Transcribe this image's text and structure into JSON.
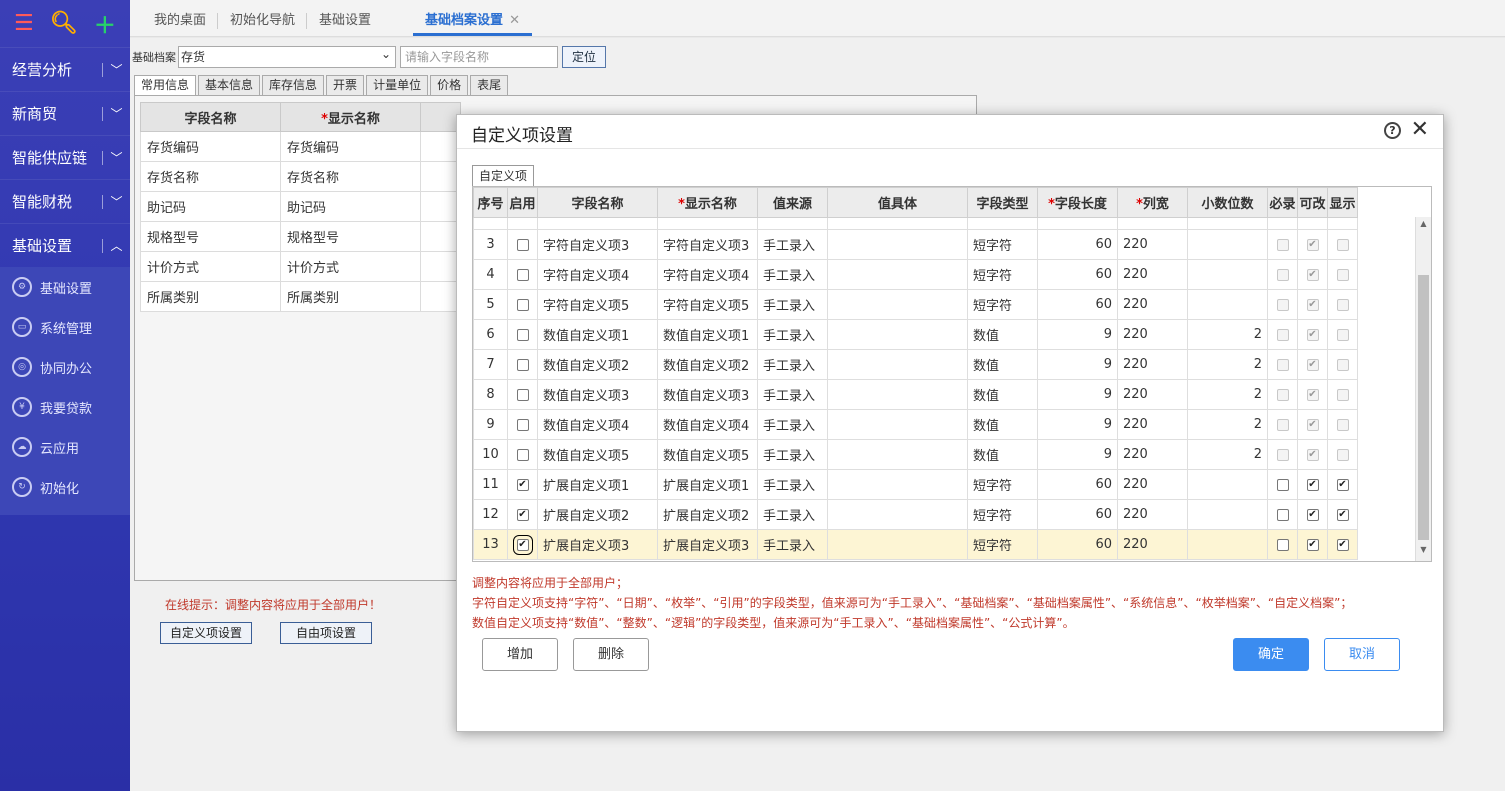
{
  "sidebar": {
    "menus": [
      {
        "label": "经营分析"
      },
      {
        "label": "新商贸"
      },
      {
        "label": "智能供应链"
      },
      {
        "label": "智能财税"
      },
      {
        "label": "基础设置"
      }
    ],
    "sub_items": [
      {
        "label": "基础设置",
        "icon": "gear-icon"
      },
      {
        "label": "系统管理",
        "icon": "monitor-icon"
      },
      {
        "label": "协同办公",
        "icon": "collaboration-icon"
      },
      {
        "label": "我要贷款",
        "icon": "money-icon"
      },
      {
        "label": "云应用",
        "icon": "cloud-icon"
      },
      {
        "label": "初始化",
        "icon": "refresh-icon"
      }
    ]
  },
  "top_tabs": [
    {
      "label": "我的桌面"
    },
    {
      "label": "初始化导航"
    },
    {
      "label": "基础设置"
    },
    {
      "label": "基础档案设置"
    }
  ],
  "filter": {
    "label": "基础档案",
    "select_value": "存货",
    "search_placeholder": "请输入字段名称",
    "locate_button": "定位"
  },
  "sub_tabs": [
    "常用信息",
    "基本信息",
    "库存信息",
    "开票",
    "计量单位",
    "价格",
    "表尾"
  ],
  "left_grid": {
    "headers": [
      "字段名称",
      "显示名称"
    ],
    "header_required_mark": "*",
    "rows": [
      [
        "存货编码",
        "存货编码"
      ],
      [
        "存货名称",
        "存货名称"
      ],
      [
        "助记码",
        "助记码"
      ],
      [
        "规格型号",
        "规格型号"
      ],
      [
        "计价方式",
        "计价方式"
      ],
      [
        "所属类别",
        "所属类别"
      ]
    ]
  },
  "left_tip": "在线提示：调整内容将应用于全部用户！",
  "left_buttons": {
    "custom": "自定义项设置",
    "free": "自由项设置"
  },
  "dialog": {
    "title": "自定义项设置",
    "tab": "自定义项",
    "headers": [
      "序号",
      "启用",
      "字段名称",
      "显示名称",
      "值来源",
      "值具体",
      "字段类型",
      "字段长度",
      "列宽",
      "小数位数",
      "必录",
      "可改",
      "显示"
    ],
    "required_mark": "*",
    "rows": [
      {
        "no": "3",
        "enabled": false,
        "field": "字符自定义项3",
        "display": "字符自定义项3",
        "source": "手工录入",
        "detail": "",
        "type": "短字符",
        "length": "60",
        "width": "220",
        "decimals": "",
        "required": false,
        "editable": true,
        "show": false,
        "locked": true
      },
      {
        "no": "4",
        "enabled": false,
        "field": "字符自定义项4",
        "display": "字符自定义项4",
        "source": "手工录入",
        "detail": "",
        "type": "短字符",
        "length": "60",
        "width": "220",
        "decimals": "",
        "required": false,
        "editable": true,
        "show": false,
        "locked": true
      },
      {
        "no": "5",
        "enabled": false,
        "field": "字符自定义项5",
        "display": "字符自定义项5",
        "source": "手工录入",
        "detail": "",
        "type": "短字符",
        "length": "60",
        "width": "220",
        "decimals": "",
        "required": false,
        "editable": true,
        "show": false,
        "locked": true
      },
      {
        "no": "6",
        "enabled": false,
        "field": "数值自定义项1",
        "display": "数值自定义项1",
        "source": "手工录入",
        "detail": "",
        "type": "数值",
        "length": "9",
        "width": "220",
        "decimals": "2",
        "required": false,
        "editable": true,
        "show": false,
        "locked": true
      },
      {
        "no": "7",
        "enabled": false,
        "field": "数值自定义项2",
        "display": "数值自定义项2",
        "source": "手工录入",
        "detail": "",
        "type": "数值",
        "length": "9",
        "width": "220",
        "decimals": "2",
        "required": false,
        "editable": true,
        "show": false,
        "locked": true
      },
      {
        "no": "8",
        "enabled": false,
        "field": "数值自定义项3",
        "display": "数值自定义项3",
        "source": "手工录入",
        "detail": "",
        "type": "数值",
        "length": "9",
        "width": "220",
        "decimals": "2",
        "required": false,
        "editable": true,
        "show": false,
        "locked": true
      },
      {
        "no": "9",
        "enabled": false,
        "field": "数值自定义项4",
        "display": "数值自定义项4",
        "source": "手工录入",
        "detail": "",
        "type": "数值",
        "length": "9",
        "width": "220",
        "decimals": "2",
        "required": false,
        "editable": true,
        "show": false,
        "locked": true
      },
      {
        "no": "10",
        "enabled": false,
        "field": "数值自定义项5",
        "display": "数值自定义项5",
        "source": "手工录入",
        "detail": "",
        "type": "数值",
        "length": "9",
        "width": "220",
        "decimals": "2",
        "required": false,
        "editable": true,
        "show": false,
        "locked": true
      },
      {
        "no": "11",
        "enabled": true,
        "field": "扩展自定义项1",
        "display": "扩展自定义项1",
        "source": "手工录入",
        "detail": "",
        "type": "短字符",
        "length": "60",
        "width": "220",
        "decimals": "",
        "required": false,
        "editable": true,
        "show": true,
        "locked": false
      },
      {
        "no": "12",
        "enabled": true,
        "field": "扩展自定义项2",
        "display": "扩展自定义项2",
        "source": "手工录入",
        "detail": "",
        "type": "短字符",
        "length": "60",
        "width": "220",
        "decimals": "",
        "required": false,
        "editable": true,
        "show": true,
        "locked": false
      },
      {
        "no": "13",
        "enabled": true,
        "field": "扩展自定义项3",
        "display": "扩展自定义项3",
        "source": "手工录入",
        "detail": "",
        "type": "短字符",
        "length": "60",
        "width": "220",
        "decimals": "",
        "required": false,
        "editable": true,
        "show": true,
        "locked": false,
        "selected": true
      }
    ],
    "notes": [
      "调整内容将应用于全部用户；",
      "字符自定义项支持“字符”、“日期”、“枚举”、“引用”的字段类型，值来源可为“手工录入”、“基础档案”、“基础档案属性”、“系统信息”、“枚举档案”、“自定义档案”；",
      "数值自定义项支持“数值”、“整数”、“逻辑”的字段类型，值来源可为“手工录入”、“基础档案属性”、“公式计算”。"
    ],
    "buttons": {
      "add": "增加",
      "delete": "删除",
      "ok": "确定",
      "cancel": "取消"
    }
  }
}
